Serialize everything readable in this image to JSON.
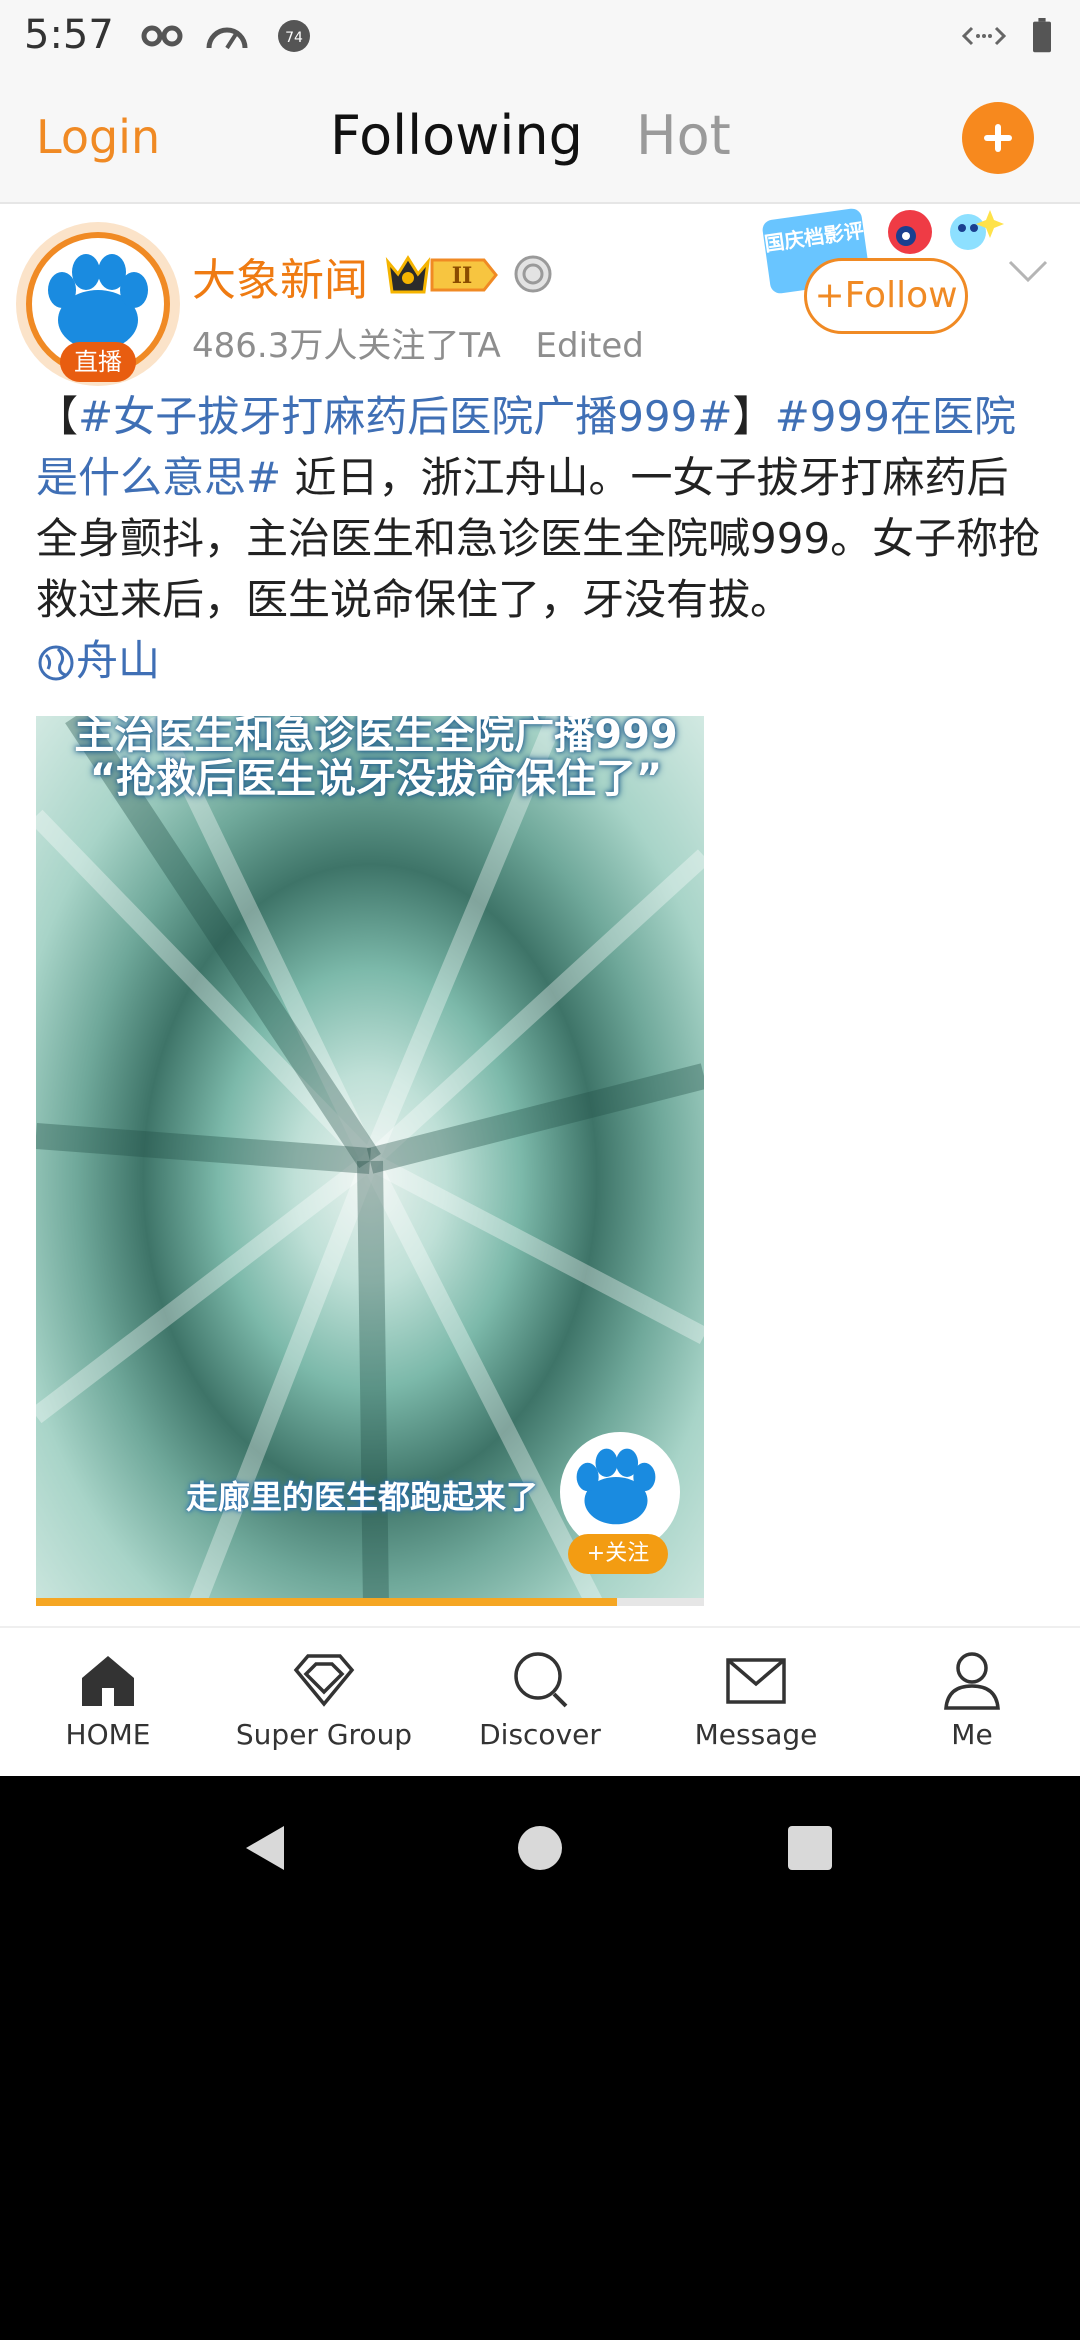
{
  "status_bar": {
    "time": "5:57"
  },
  "top_nav": {
    "login": "Login",
    "tabs": [
      {
        "label": "Following"
      },
      {
        "label": "Hot"
      }
    ]
  },
  "post": {
    "author": "大象新闻",
    "crown_rank": "II",
    "live_badge": "直播",
    "followers": "486.3万人关注了TA",
    "edited": "Edited",
    "promo_text": "国庆档影评",
    "follow_label": "+Follow",
    "text": {
      "bracket_open": "【",
      "tag1": "#女子拔牙打麻药后医院广播999#",
      "bracket_close": "】",
      "tag2": "#999在医院是什么意思#",
      "body": " 近日，浙江舟山。一女子拔牙打麻药后全身颤抖，主治医生和急诊医生全院喊999。女子称抢救过来后，医生说命保住了，牙没有拔。",
      "location": "舟山"
    },
    "video": {
      "caption_top": "主治医生和急诊医生全院广播999",
      "caption_quote": "“抢救后医生说牙没拔命保住了”",
      "caption_bottom": "走廊里的医生都跑起来了",
      "follow_badge": "+关注",
      "progress": 0.87
    }
  },
  "bottom_nav": [
    {
      "label": "HOME",
      "icon": "home-icon"
    },
    {
      "label": "Super Group",
      "icon": "diamond-icon"
    },
    {
      "label": "Discover",
      "icon": "search-icon"
    },
    {
      "label": "Message",
      "icon": "envelope-icon"
    },
    {
      "label": "Me",
      "icon": "person-icon"
    }
  ],
  "colors": {
    "accent": "#f08a24",
    "link": "#3f6fb5"
  }
}
